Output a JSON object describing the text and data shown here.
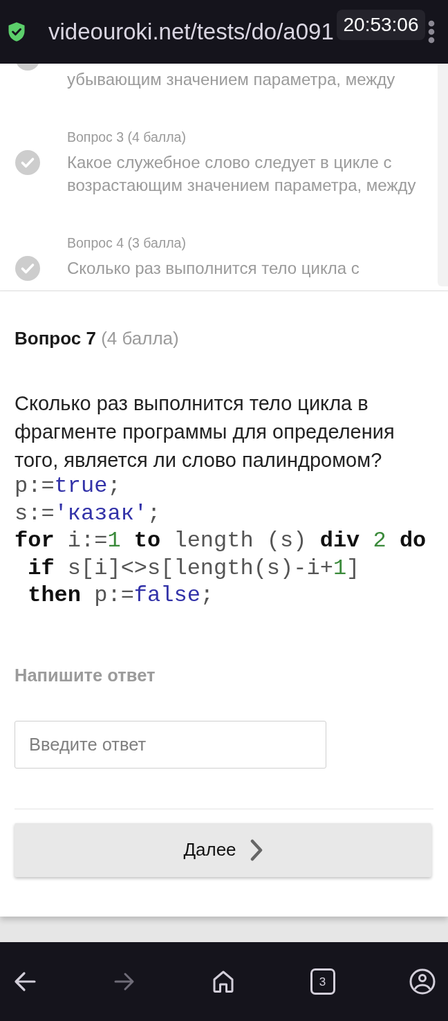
{
  "address_bar": {
    "secure": true,
    "url": "videouroki.net/tests/do/a091",
    "recording_time": "20:53:06"
  },
  "question_list": [
    {
      "text": "убывающим значением параметра, между",
      "answered": true
    },
    {
      "title": "Вопрос 3 (4 балла)",
      "text": "Какое служебное слово следует в цикле с возрастающим значением параметра, между",
      "answered": true
    },
    {
      "title": "Вопрос 4 (3 балла)",
      "text": "Сколько раз выполнится тело цикла с",
      "answered": true
    }
  ],
  "question": {
    "number": "Вопрос 7",
    "points": "(4 балла)",
    "text": "Сколько раз выполнится тело цикла в фрагменте программы для определения того, является ли слово палиндромом?",
    "code": [
      [
        {
          "text": "p:=",
          "kind": "plain"
        },
        {
          "text": "true",
          "kind": "literal"
        },
        {
          "text": ";",
          "kind": "plain"
        }
      ],
      [
        {
          "text": "s:=",
          "kind": "plain"
        },
        {
          "text": "'казак'",
          "kind": "literal"
        },
        {
          "text": ";",
          "kind": "plain"
        }
      ],
      [
        {
          "text": "for",
          "kind": "keyword"
        },
        {
          "text": " i:=",
          "kind": "plain"
        },
        {
          "text": "1",
          "kind": "number"
        },
        {
          "text": " to",
          "kind": "keyword"
        },
        {
          "text": " length (s) ",
          "kind": "plain"
        },
        {
          "text": "div",
          "kind": "keyword"
        },
        {
          "text": " 2",
          "kind": "number"
        },
        {
          "text": " do",
          "kind": "keyword"
        }
      ],
      [
        {
          "text": " if",
          "kind": "keyword"
        },
        {
          "text": " s[i]<>s[length(s)-i+",
          "kind": "plain"
        },
        {
          "text": "1",
          "kind": "number"
        },
        {
          "text": "]",
          "kind": "plain"
        }
      ],
      [
        {
          "text": " then",
          "kind": "keyword"
        },
        {
          "text": " p:=",
          "kind": "plain"
        },
        {
          "text": "false",
          "kind": "literal"
        },
        {
          "text": ";",
          "kind": "plain"
        }
      ]
    ],
    "answer_label": "Напишите ответ",
    "answer_field": {
      "placeholder": "Введите ответ"
    },
    "next_button": "Далее"
  },
  "bottom_nav": [
    {
      "kind": "back",
      "disabled": false
    },
    {
      "kind": "forward",
      "disabled": true
    },
    {
      "kind": "home",
      "disabled": false
    },
    {
      "kind": "tabs",
      "count": "3",
      "disabled": false
    },
    {
      "kind": "account",
      "disabled": false
    }
  ]
}
